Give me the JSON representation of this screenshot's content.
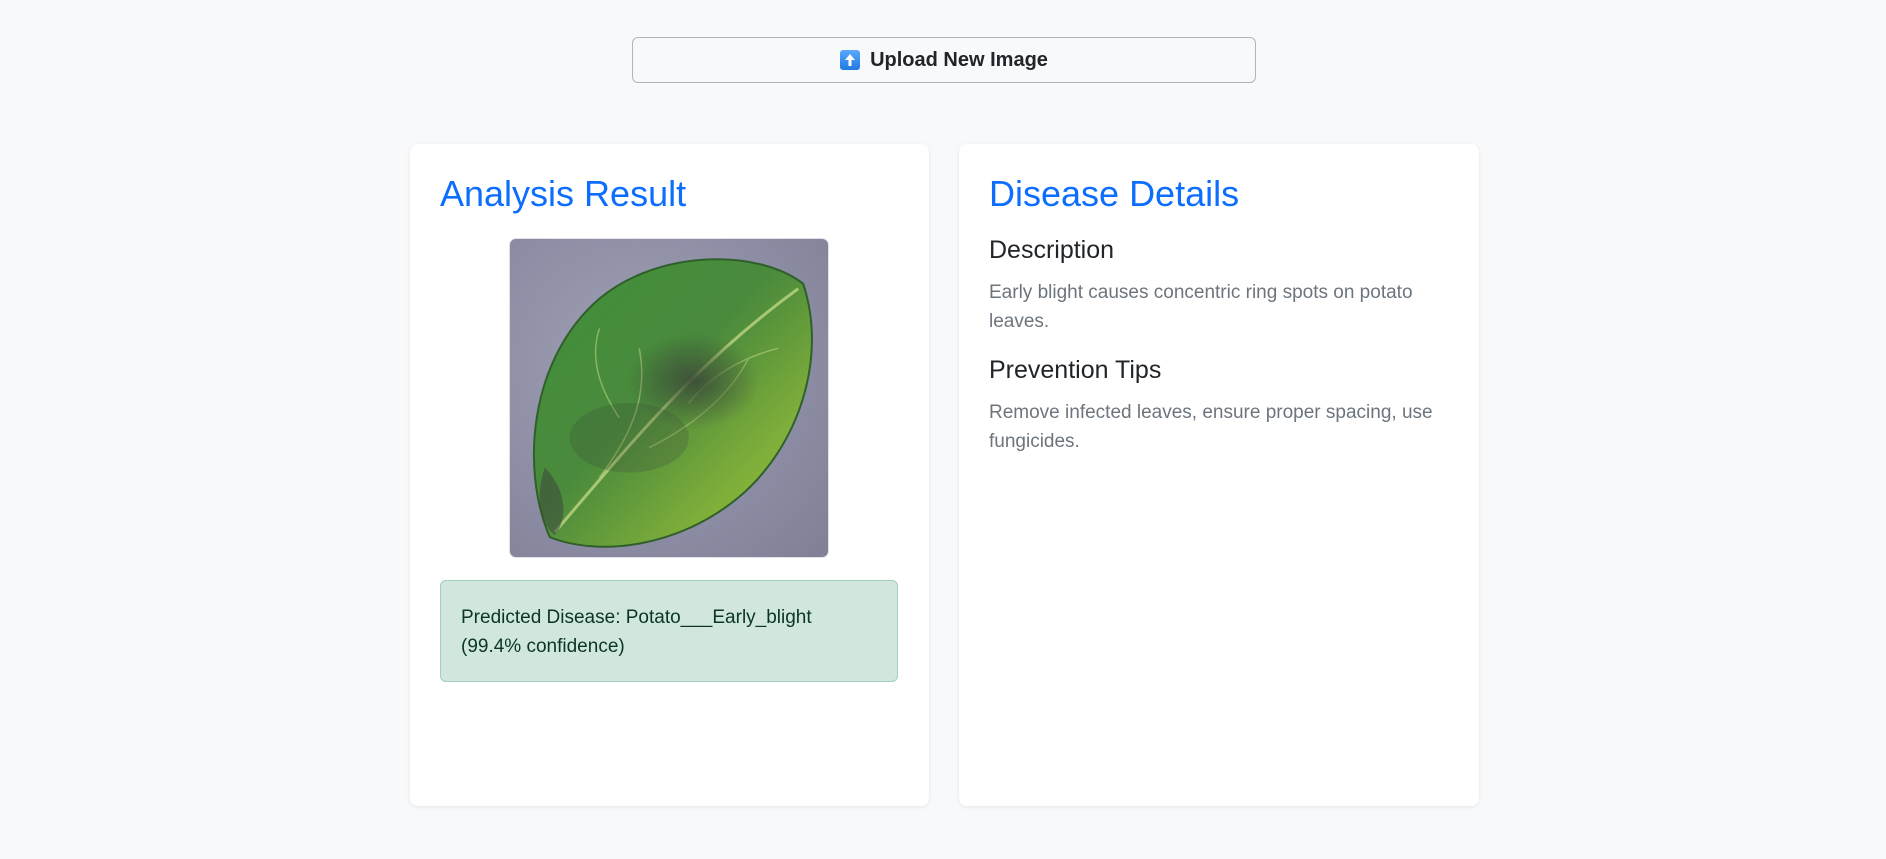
{
  "upload": {
    "label": "Upload New Image",
    "icon": "up-arrow-icon"
  },
  "analysis": {
    "title": "Analysis Result",
    "prediction": "Predicted Disease: Potato___Early_blight (99.4% confidence)"
  },
  "details": {
    "title": "Disease Details",
    "description_heading": "Description",
    "description_text": "Early blight causes concentric ring spots on potato leaves.",
    "prevention_heading": "Prevention Tips",
    "prevention_text": "Remove infected leaves, ensure proper spacing, use fungicides."
  },
  "colors": {
    "accent": "#0d6efd",
    "success_bg": "#d1e7dd",
    "success_border": "#a3cfbb",
    "success_text": "#0a3622",
    "page_bg": "#f8f9fa"
  }
}
